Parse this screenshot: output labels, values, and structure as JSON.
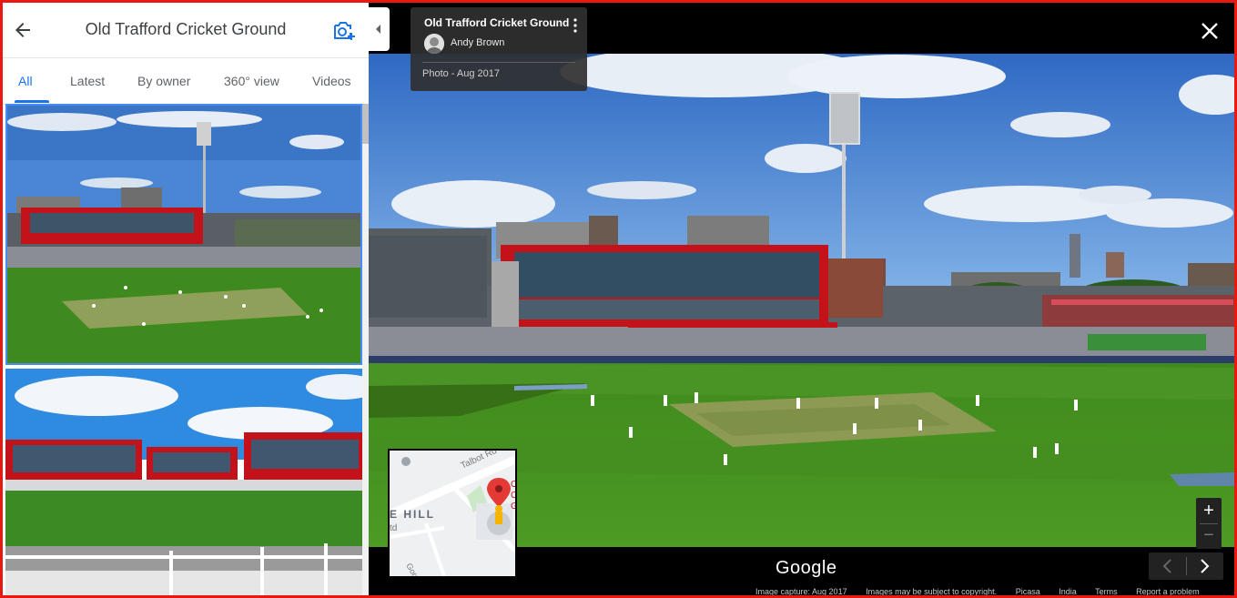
{
  "left_panel": {
    "title": "Old Trafford Cricket Ground",
    "tabs": [
      {
        "label": "All",
        "active": true
      },
      {
        "label": "Latest"
      },
      {
        "label": "By owner"
      },
      {
        "label": "360° view"
      },
      {
        "label": "Videos"
      }
    ]
  },
  "info_card": {
    "title": "Old Trafford Cricket Ground",
    "author": "Andy Brown",
    "date": "Photo - Aug 2017"
  },
  "minimap": {
    "road_label": "Talbot Rd",
    "area_label": "E HILL",
    "side_letters": [
      "O",
      "C",
      "G"
    ],
    "small_letters": [
      "td"
    ],
    "bottom_label": "Gorse C"
  },
  "viewer": {
    "brand": "Google",
    "footer": [
      "Image capture: Aug 2017",
      "Images may be subject to copyright.",
      "Picasa",
      "India",
      "Terms",
      "Report a problem"
    ],
    "zoom_in": "+",
    "zoom_out": "−"
  },
  "colors": {
    "accent": "#1a73e8",
    "frame": "#e8190f",
    "stand_red": "#c4121a",
    "pitch_green": "#3f8a1f"
  }
}
